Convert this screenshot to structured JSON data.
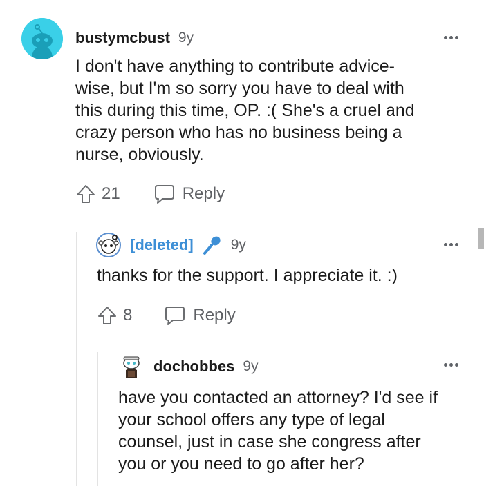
{
  "comments": [
    {
      "username": "bustymcbust",
      "age": "9y",
      "body_lines": [
        "I don't have anything to contribute advice-",
        "wise, but I'm so sorry you have to deal with",
        "this during this time, OP. :( She's a cruel and",
        "crazy person who has no business being a",
        "nurse, obviously."
      ],
      "upvotes": "21",
      "reply_label": "Reply",
      "avatar_color": "#3ad0e8"
    },
    {
      "username": "[deleted]",
      "age": "9y",
      "body_lines": [
        "thanks for the support. I appreciate it. :)"
      ],
      "upvotes": "8",
      "reply_label": "Reply",
      "username_color": "#3d8fd6"
    },
    {
      "username": "dochobbes",
      "age": "9y",
      "body_lines": [
        "have you contacted an attorney? I'd see if",
        "your school offers any type of legal",
        "counsel, just in case she congress after",
        "you or you need to go after her?"
      ]
    }
  ]
}
